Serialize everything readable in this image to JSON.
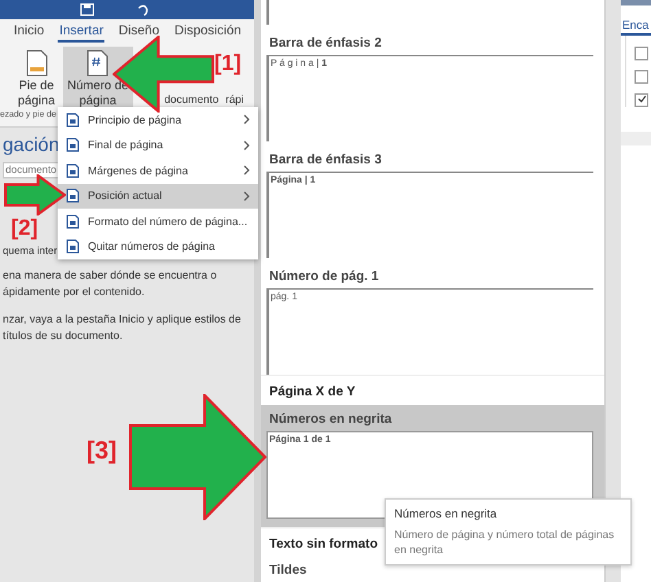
{
  "ribbon": {
    "tabs": [
      {
        "label": "Inicio",
        "selected": false
      },
      {
        "label": "Insertar",
        "selected": true
      },
      {
        "label": "Diseño",
        "selected": false
      },
      {
        "label": "Disposición",
        "selected": false
      }
    ],
    "buttons": [
      {
        "kind": "icon",
        "lines": [
          "Pie de",
          "página"
        ],
        "selected": false
      },
      {
        "kind": "icon",
        "lines": [
          "Número de",
          "página"
        ],
        "selected": true
      },
      {
        "kind": "partial",
        "lines": [
          "documento"
        ],
        "selected": false
      },
      {
        "kind": "partial",
        "lines": [
          "rápi"
        ],
        "selected": false
      }
    ],
    "group_label": "ezado y pie de"
  },
  "navigation": {
    "title": "gación",
    "search": {
      "value": "documento"
    },
    "heading_tab": "quema inter",
    "paragraphs": [
      "ena manera de saber dónde se encuentra o",
      "ápidamente por el contenido.",
      "nzar, vaya a la pestaña Inicio y aplique estilos de",
      "títulos de su documento."
    ]
  },
  "menu": {
    "items": [
      {
        "label": "Principio de página",
        "submenu": true,
        "selected": false
      },
      {
        "label": "Final de página",
        "submenu": true,
        "selected": false
      },
      {
        "label": "Márgenes de página",
        "submenu": true,
        "selected": false
      },
      {
        "label": "Posición actual",
        "submenu": true,
        "selected": true
      },
      {
        "label": "Formato del número de página...",
        "submenu": false,
        "selected": false
      },
      {
        "label": "Quitar números de página",
        "submenu": false,
        "selected": false
      }
    ]
  },
  "gallery": {
    "items": [
      {
        "kind": "preview",
        "selected": false
      },
      {
        "kind": "preview",
        "title": "Barra de énfasis 2",
        "sample": "P á g i n a | **1**",
        "selected": false
      },
      {
        "kind": "preview",
        "title": "Barra de énfasis 3",
        "sample": "**Página | 1**",
        "selected": false
      },
      {
        "kind": "preview",
        "title": "Número de pág. 1",
        "sample": "pág. 1",
        "selected": false
      },
      {
        "kind": "section",
        "title": "Página X de Y"
      },
      {
        "kind": "preview",
        "title": "Números en negrita",
        "sample": "**Página 1 de 1**",
        "selected": true
      },
      {
        "kind": "section",
        "title": "Texto sin formato"
      },
      {
        "kind": "preview",
        "title": "Tildes",
        "selected": false
      }
    ]
  },
  "tooltip": {
    "title": "Números en negrita",
    "description": "Número de página y número total de páginas en negrita"
  },
  "side_pane": {
    "tab": "Enca",
    "checkboxes": [
      {
        "checked": false
      },
      {
        "checked": false
      },
      {
        "checked": true
      }
    ]
  },
  "annotations": [
    {
      "label": "[1]",
      "kind": "arrow_left"
    },
    {
      "label": "[2]",
      "kind": "arrow_right"
    },
    {
      "label": "[3]",
      "kind": "arrow_right"
    }
  ]
}
